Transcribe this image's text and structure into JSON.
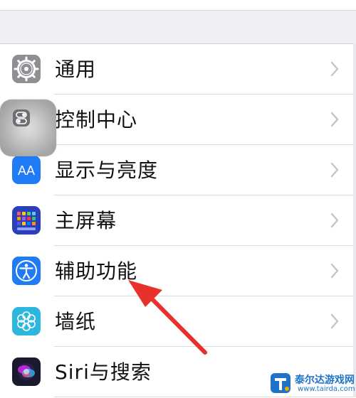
{
  "settings": {
    "items": [
      {
        "label": "通用",
        "icon": "gear-icon",
        "icon_color": "#8e8e93"
      },
      {
        "label": "控制中心",
        "icon": "toggles-icon",
        "icon_color": "#8e8e93"
      },
      {
        "label": "显示与亮度",
        "icon": "text-size-icon",
        "icon_color": "#1f7cf6",
        "icon_text": "AA"
      },
      {
        "label": "主屏幕",
        "icon": "home-screen-icon",
        "icon_color": "#2a3fb9"
      },
      {
        "label": "辅助功能",
        "icon": "accessibility-icon",
        "icon_color": "#1f7cf6"
      },
      {
        "label": "墙纸",
        "icon": "flower-icon",
        "icon_color": "#2db6de"
      },
      {
        "label": "Siri与搜索",
        "icon": "siri-icon",
        "icon_color": "#1a1a2e"
      }
    ]
  },
  "annotation": {
    "color": "#e8312a"
  },
  "watermark": {
    "name": "泰尔达游戏网",
    "url": "www.tairda.com"
  }
}
